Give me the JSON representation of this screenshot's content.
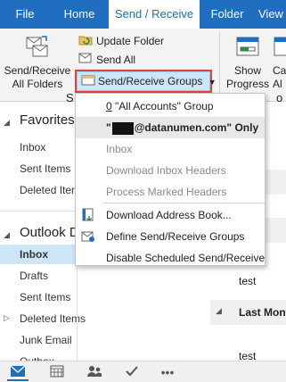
{
  "tabs": [
    {
      "label": "File"
    },
    {
      "label": "Home"
    },
    {
      "label": "Send / Receive"
    },
    {
      "label": "Folder"
    },
    {
      "label": "View"
    }
  ],
  "ribbon": {
    "send_receive_all": "Send/Receive",
    "send_receive_all_2": "All Folders",
    "update_folder": "Update Folder",
    "send_all": "Send All",
    "groups_button": "Send/Receive Groups",
    "show_progress": "Show",
    "show_progress_2": "Progress",
    "cancel": "Ca",
    "cancel_2": "Al",
    "s_label": "S",
    "o_label": "o"
  },
  "nav": {
    "favorites": "Favorites",
    "fav_items": [
      "Inbox",
      "Sent Items",
      "Deleted Item"
    ],
    "account": "Outlook D",
    "acc_items": [
      "Inbox",
      "Drafts",
      "Sent Items",
      "Deleted Items",
      "Junk Email",
      "Outbox"
    ]
  },
  "rightpane": {
    "text1": "test",
    "last_month": "Last Mont",
    "text2": "test"
  },
  "menu": {
    "all_accounts_prefix": "0",
    "all_accounts": " \"All Accounts\" Group",
    "account_prefix": "\"",
    "account_suffix": "@datanumen.com\" Only",
    "inbox": "Inbox",
    "download_headers": "Download Inbox Headers",
    "process_headers": "Process Marked Headers",
    "download_address_book": "Download Address Book...",
    "define_groups": "Define Send/Receive Groups",
    "disable_scheduled": "Disable Scheduled Send/Receive"
  },
  "colors": {
    "brand": "#1f6ec0",
    "highlight": "#cde6f7",
    "outline": "#d9463b"
  }
}
